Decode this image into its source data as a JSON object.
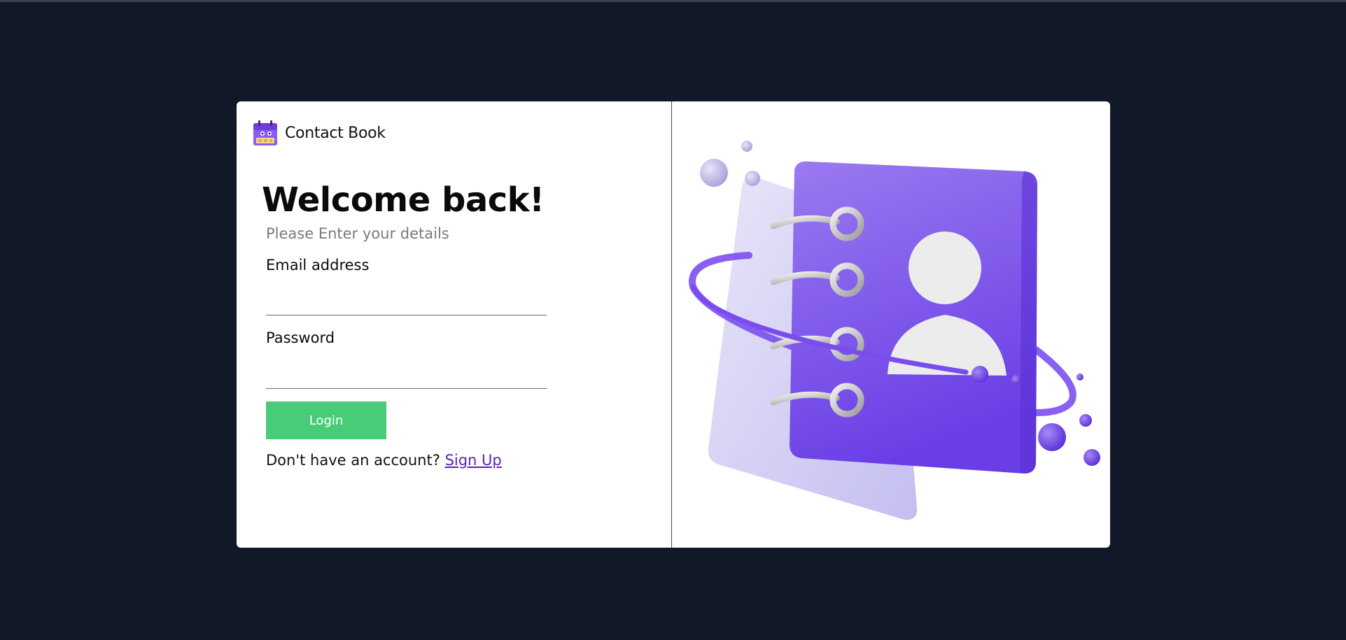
{
  "brand": {
    "name": "Contact Book",
    "logo_icon": "calendar-book-icon"
  },
  "login_form": {
    "title": "Welcome back!",
    "subtitle": "Please Enter your details",
    "email_label": "Email address",
    "email_value": "",
    "password_label": "Password",
    "password_value": "",
    "login_label": "Login",
    "signup_prompt": "Don't have an account?",
    "signup_link": "Sign Up"
  },
  "illustration": {
    "icon": "contact-book-illustration"
  },
  "colors": {
    "background": "#111827",
    "card": "#ffffff",
    "accent_green": "#48cc77",
    "accent_purple": "#7c3aed",
    "link_purple": "#5b21b6"
  }
}
